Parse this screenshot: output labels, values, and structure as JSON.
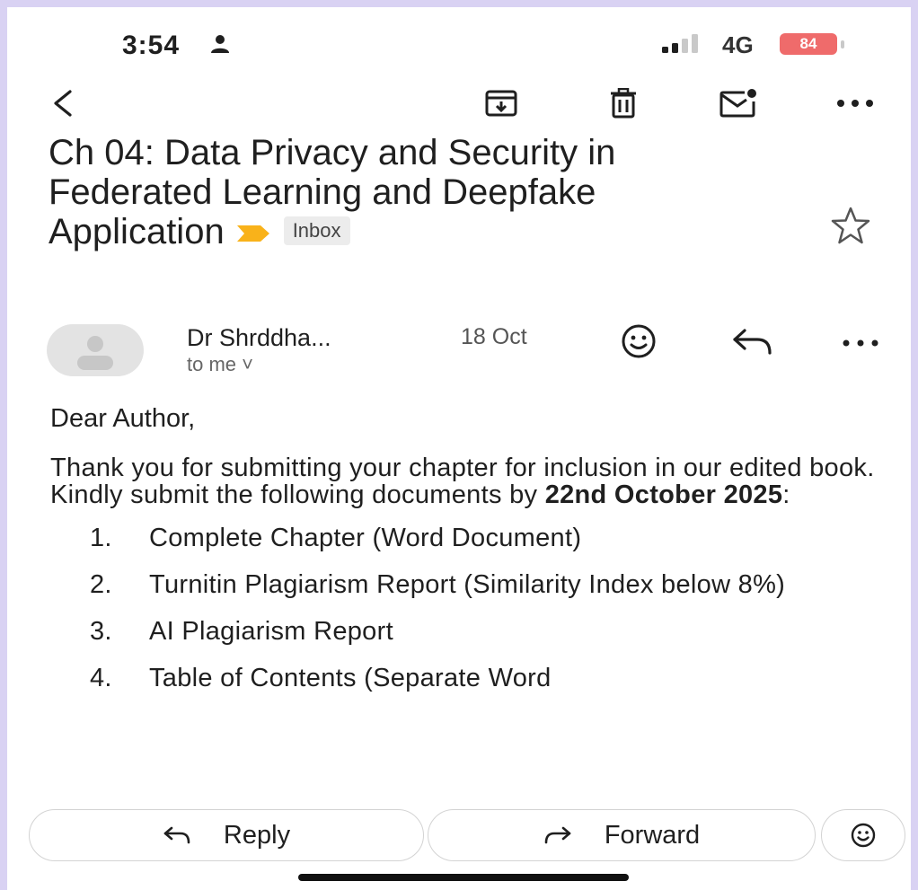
{
  "status": {
    "time": "3:54",
    "network": "4G",
    "battery": "84"
  },
  "toolbar": {
    "back": "back-arrow-icon",
    "archive": "archive-icon",
    "delete": "trash-icon",
    "mark_unread": "mail-unread-icon",
    "more": "more-horizontal-icon"
  },
  "email": {
    "subject": "Ch 04: Data Privacy and Security in Federated Learning and Deepfake Application",
    "label": "Inbox",
    "sender": "Dr Shrddha...",
    "date": "18 Oct",
    "recipient": "to me ˅",
    "greeting": "Dear Author,",
    "intro": "Thank you for submitting your chapter for inclusion in our edited book. Kindly submit the following documents by ",
    "deadline": "22nd October 2025",
    "intro_end": ":",
    "items": [
      {
        "num": "1.",
        "text": "Complete Chapter (Word Document)"
      },
      {
        "num": "2.",
        "text": "Turnitin Plagiarism Report (Similarity Index below 8%)"
      },
      {
        "num": "3.",
        "text": "AI Plagiarism Report"
      },
      {
        "num": "4.",
        "text": "Table of Contents (Separate Word"
      }
    ]
  },
  "actions": {
    "reply": "Reply",
    "forward": "Forward"
  },
  "colors": {
    "battery": "#ef6b6b",
    "label_arrow": "#f9b21a",
    "background": "#d9d2f3"
  }
}
